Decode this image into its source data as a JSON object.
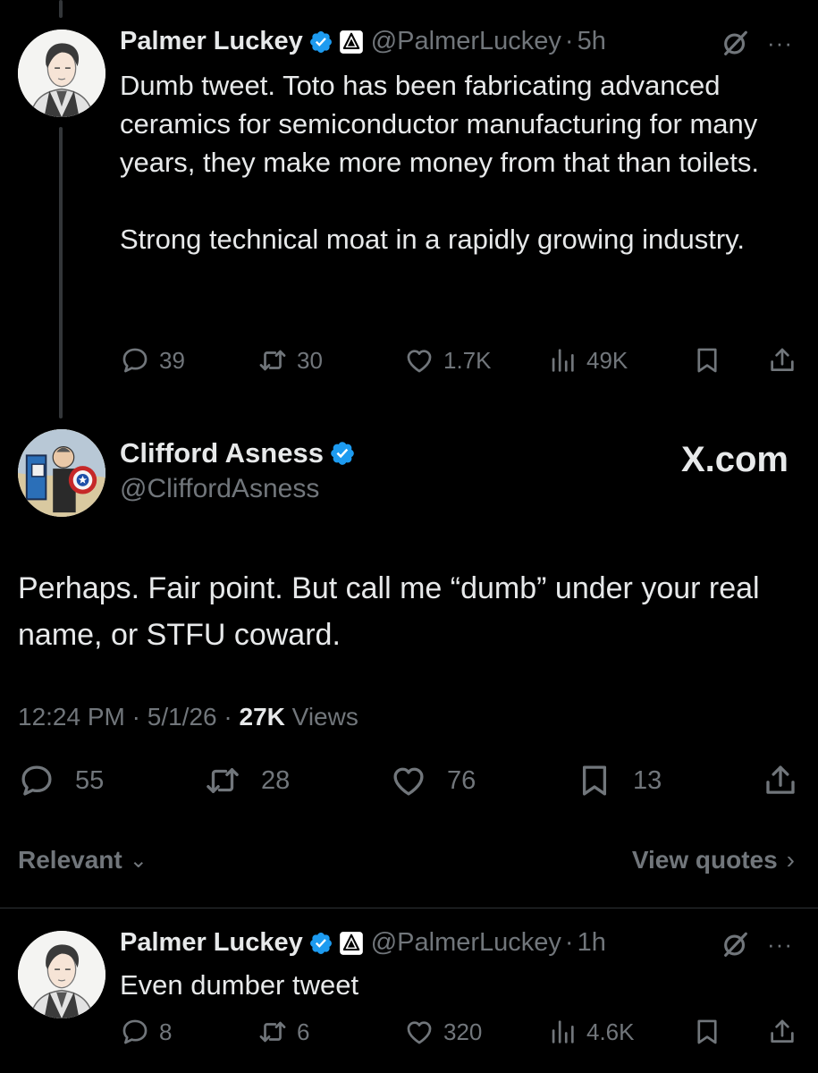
{
  "parent_tweet": {
    "author_name": "Palmer Luckey",
    "handle": "@PalmerLuckey",
    "separator": "·",
    "time": "5h",
    "text_p1": "Dumb tweet.  Toto has been fabricating advanced ceramics for semiconductor manufacturing for many years, they make more money from that than toilets.",
    "text_p2": "Strong technical moat in a rapidly growing industry.",
    "replies": "39",
    "reposts": "30",
    "likes": "1.7K",
    "views": "49K"
  },
  "main_tweet": {
    "author_name": "Clifford Asness",
    "handle": "@CliffordAsness",
    "watermark": "X.com",
    "text": "Perhaps. Fair point. But call me “dumb” under your real name, or STFU coward.",
    "time": "12:24 PM",
    "sep": "·",
    "date": "5/1/26",
    "view_count": "27K",
    "views_label": "Views",
    "replies": "55",
    "reposts": "28",
    "likes": "76",
    "bookmarks": "13"
  },
  "sort": {
    "label": "Relevant",
    "chevron": "⌄",
    "view_quotes": "View quotes",
    "quotes_chevron": "›"
  },
  "reply_tweet": {
    "author_name": "Palmer Luckey",
    "handle": "@PalmerLuckey",
    "separator": "·",
    "time": "1h",
    "text": "Even dumber tweet",
    "replies": "8",
    "reposts": "6",
    "likes": "320",
    "views": "4.6K"
  },
  "icons": {
    "verified": "verified-badge-icon",
    "affiliate": "anduril-affiliate-icon",
    "grok": "grok-icon",
    "more": "more-icon",
    "reply": "reply-icon",
    "repost": "repost-icon",
    "like": "like-icon",
    "views": "views-icon",
    "bookmark": "bookmark-icon",
    "share": "share-icon"
  },
  "colors": {
    "background": "#000000",
    "text": "#e7e9ea",
    "muted": "#71767b",
    "verified_blue": "#1d9bf0",
    "divider": "#2f3336"
  }
}
